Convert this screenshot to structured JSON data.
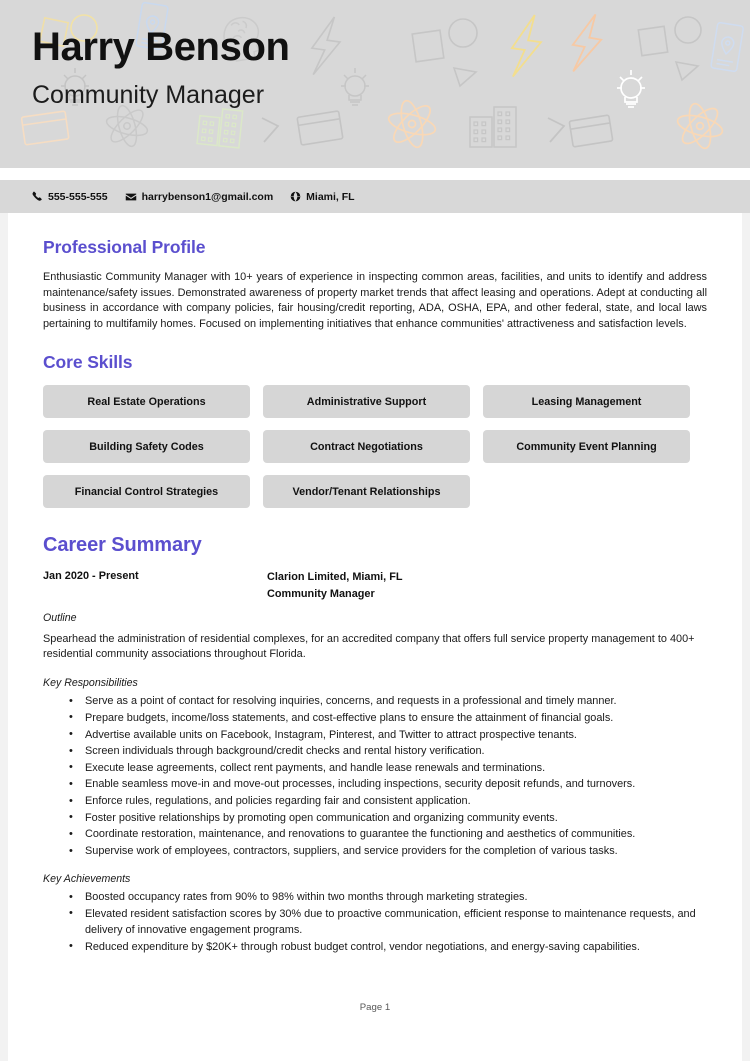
{
  "header": {
    "name": "Harry Benson",
    "title": "Community Manager",
    "background_color": "#d8d8d8",
    "decorative_icons": [
      "square-icon",
      "circle-icon",
      "phone-pin-icon",
      "head-brain-icon",
      "lightning-bolt-icon",
      "lightbulb-icon",
      "window-icon",
      "atom-icon",
      "building-icon",
      "triangle-icon",
      "chevron-icon"
    ]
  },
  "contact": {
    "phone": "555-555-555",
    "email": "harrybenson1@gmail.com",
    "location": "Miami, FL",
    "phone_icon": "phone-icon",
    "email_icon": "envelope-icon",
    "location_icon": "globe-icon"
  },
  "accent_color": "#5b4fce",
  "sections": {
    "profile": {
      "heading": "Professional Profile",
      "text": "Enthusiastic Community Manager with 10+ years of experience in inspecting common areas, facilities, and units to identify and address maintenance/safety issues. Demonstrated awareness of property market trends that affect leasing and operations. Adept at conducting all business in accordance with company policies, fair housing/credit reporting, ADA, OSHA, EPA, and other federal, state, and local laws pertaining to multifamily homes. Focused on implementing initiatives that enhance communities' attractiveness and satisfaction levels."
    },
    "skills": {
      "heading": "Core Skills",
      "items": [
        "Real Estate Operations",
        "Administrative Support",
        "Leasing Management",
        "Building Safety Codes",
        "Contract Negotiations",
        "Community Event Planning",
        "Financial Control Strategies",
        "Vendor/Tenant Relationships"
      ]
    },
    "career": {
      "heading": "Career Summary",
      "entries": [
        {
          "dates": "Jan 2020 - Present",
          "company": "Clarion Limited, Miami, FL",
          "role": "Community Manager",
          "outline_label": "Outline",
          "outline": "Spearhead the administration of residential complexes, for an accredited company that offers full service property management to 400+ residential community associations throughout Florida.",
          "responsibilities_label": "Key Responsibilities",
          "responsibilities": [
            "Serve as a point of contact for resolving inquiries, concerns, and requests in a professional and timely manner.",
            "Prepare budgets, income/loss statements, and cost-effective plans to ensure the attainment of financial goals.",
            "Advertise available units on Facebook, Instagram, Pinterest, and Twitter to attract prospective tenants.",
            "Screen individuals through background/credit checks and rental history verification.",
            "Execute lease agreements, collect rent payments, and handle lease renewals and terminations.",
            "Enable seamless move-in and move-out processes, including inspections, security deposit refunds, and turnovers.",
            "Enforce rules, regulations, and policies regarding fair and consistent application.",
            "Foster positive relationships by promoting open communication and organizing community events.",
            "Coordinate restoration, maintenance, and renovations to guarantee the functioning and aesthetics of communities.",
            "Supervise work of employees, contractors, suppliers, and service providers for the completion of various tasks."
          ],
          "achievements_label": "Key Achievements",
          "achievements": [
            "Boosted occupancy rates from 90% to 98% within two months through marketing strategies.",
            "Elevated resident satisfaction scores by 30% due to proactive communication, efficient response to maintenance requests, and delivery of innovative engagement programs.",
            "Reduced expenditure by $20K+ through robust budget control, vendor negotiations, and energy-saving capabilities."
          ]
        }
      ]
    }
  },
  "footer": {
    "page_label": "Page 1"
  }
}
